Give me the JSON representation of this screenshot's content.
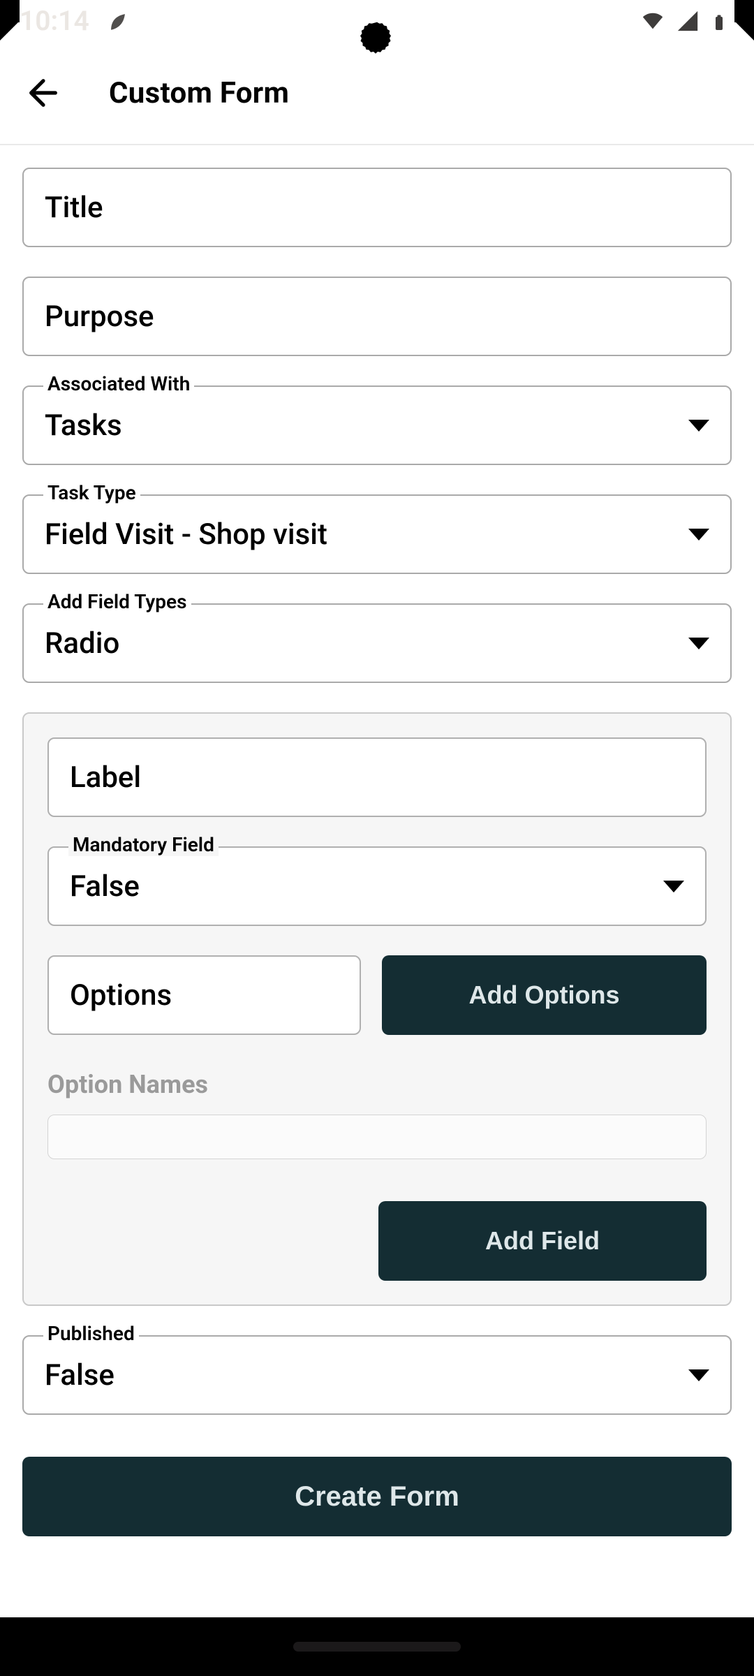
{
  "status": {
    "time": "10:14"
  },
  "header": {
    "title": "Custom Form"
  },
  "form": {
    "title_placeholder": "Title",
    "purpose_placeholder": "Purpose",
    "associated_with": {
      "label": "Associated With",
      "value": "Tasks"
    },
    "task_type": {
      "label": "Task Type",
      "value": "Field Visit - Shop visit"
    },
    "field_types": {
      "label": "Add Field Types",
      "value": "Radio"
    }
  },
  "field_config": {
    "label_placeholder": "Label",
    "mandatory": {
      "label": "Mandatory Field",
      "value": "False"
    },
    "options_placeholder": "Options",
    "add_options_label": "Add Options",
    "option_names_heading": "Option Names",
    "add_field_label": "Add Field"
  },
  "published": {
    "label": "Published",
    "value": "False"
  },
  "submit_label": "Create Form"
}
